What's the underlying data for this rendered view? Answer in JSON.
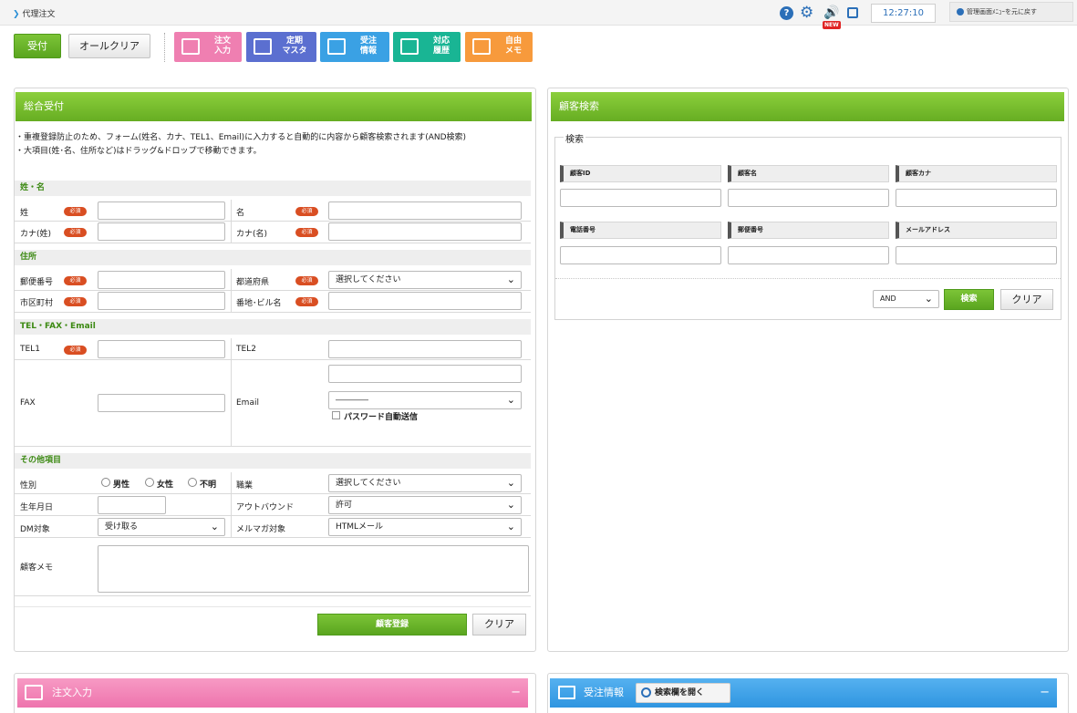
{
  "topbar": {
    "breadcrumb": "代理注文",
    "help_glyph": "?",
    "new_badge": "NEW",
    "clock": "12:27:10",
    "admin_back": "管理画面ﾒﾆｭｰを元に戻す"
  },
  "toolbar": {
    "accept_label": "受付",
    "clear_all_label": "オールクリア",
    "tiles": [
      {
        "line1": "注文",
        "line2": "入力",
        "color": "#ef7fb1"
      },
      {
        "line1": "定期",
        "line2": "マスタ",
        "color": "#5b6fd0"
      },
      {
        "line1": "受注",
        "line2": "情報",
        "color": "#3aa1e4"
      },
      {
        "line1": "対応",
        "line2": "履歴",
        "color": "#19b594"
      },
      {
        "line1": "自由",
        "line2": "メモ",
        "color": "#f79a3c"
      }
    ]
  },
  "general": {
    "title": "総合受付",
    "note1": "・重複登録防止のため、フォーム(姓名、カナ、TEL1、Email)に入力すると自動的に内容から顧客検索されます(AND検索)",
    "note2": "・大項目(姓･名、住所など)はドラッグ&ドロップで移動できます。",
    "required": "必須",
    "sec_name": "姓・名",
    "lbl_sei": "姓",
    "lbl_mei": "名",
    "lbl_kana_sei": "カナ(姓)",
    "lbl_kana_mei": "カナ(名)",
    "sec_address": "住所",
    "lbl_zip": "郵便番号",
    "lbl_pref": "都道府県",
    "pref_value": "選択してください",
    "lbl_city": "市区町村",
    "lbl_street": "番地･ビル名",
    "sec_contact": "TEL・FAX・Email",
    "lbl_tel1": "TEL1",
    "lbl_tel2": "TEL2",
    "lbl_fax": "FAX",
    "lbl_email": "Email",
    "email_select": "――――",
    "password_auto": "パスワード自動送信",
    "sec_other": "その他項目",
    "lbl_gender": "性別",
    "gender_male": "男性",
    "gender_female": "女性",
    "gender_unknown": "不明",
    "lbl_job": "職業",
    "job_value": "選択してください",
    "lbl_birth": "生年月日",
    "lbl_outbound": "アウトバウンド",
    "outbound_value": "許可",
    "lbl_dm": "DM対象",
    "dm_value": "受け取る",
    "lbl_mailmag": "メルマガ対象",
    "mailmag_value": "HTMLメール",
    "lbl_memo": "顧客メモ",
    "register_label": "顧客登録",
    "clear_label": "クリア"
  },
  "search": {
    "title": "顧客検索",
    "legend": "検索",
    "h_id": "顧客ID",
    "h_name": "顧客名",
    "h_kana": "顧客カナ",
    "h_phone": "電話番号",
    "h_zip": "郵便番号",
    "h_mail": "メールアドレス",
    "mode_value": "AND",
    "search_label": "検索",
    "clear_label": "クリア"
  },
  "bottom": {
    "order_title": "注文入力",
    "order_collapse": "−",
    "order_info_title": "受注情報",
    "open_search_label": "検索欄を開く",
    "info_collapse": "−"
  }
}
